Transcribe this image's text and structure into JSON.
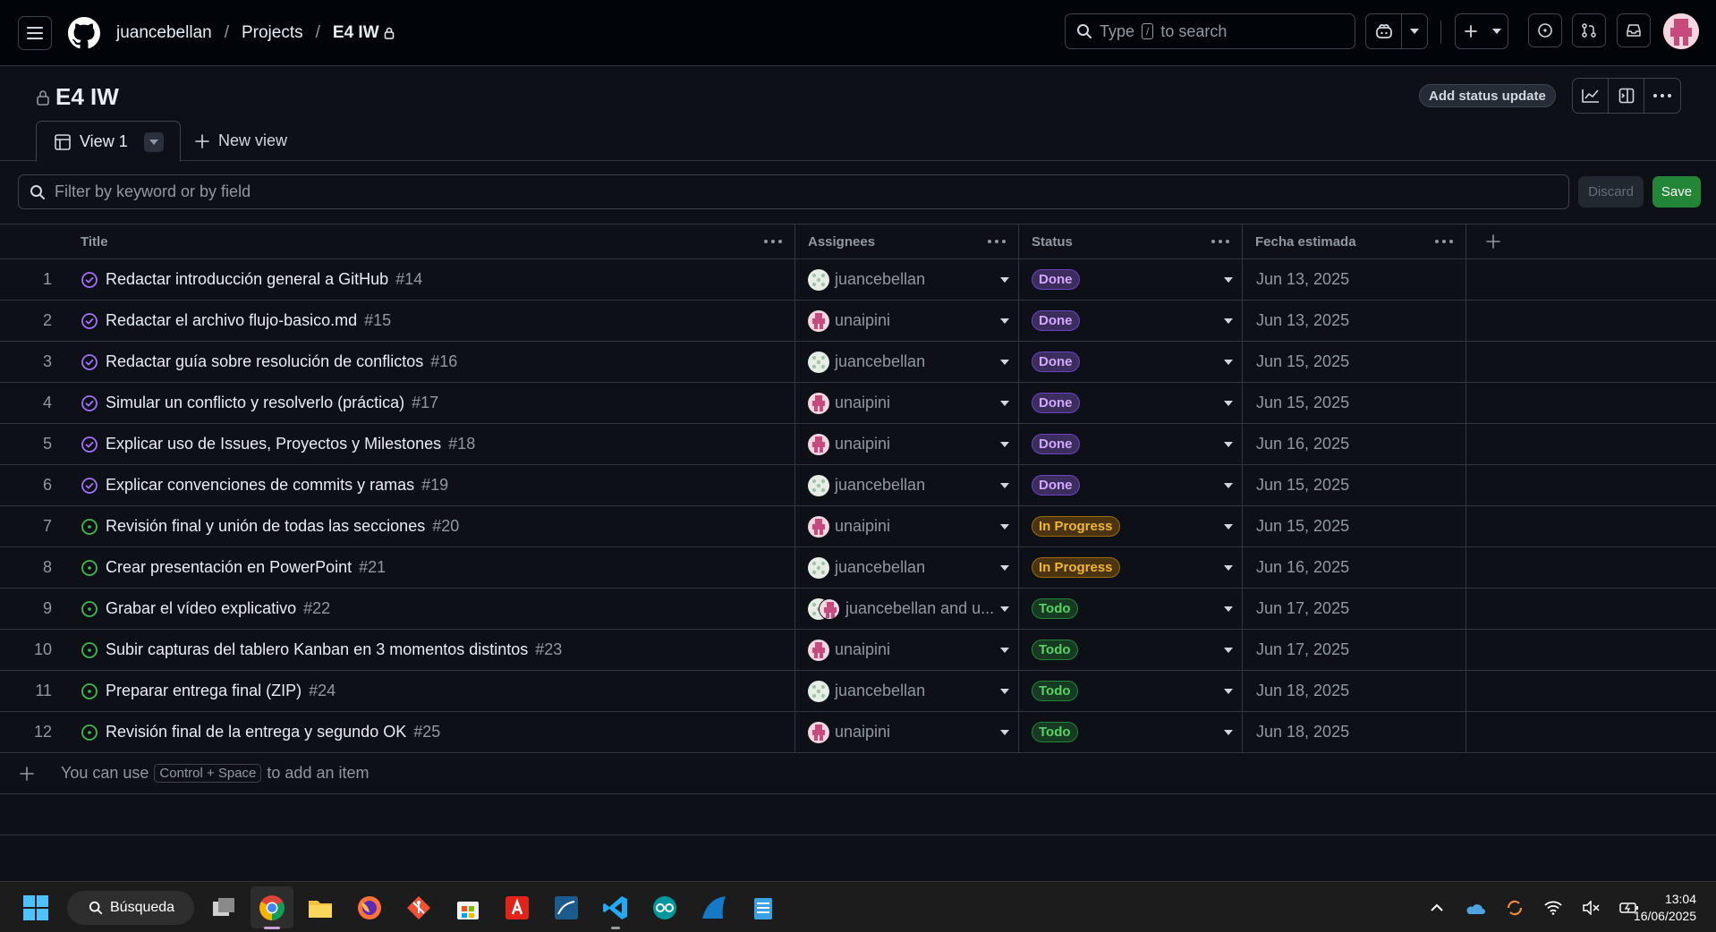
{
  "header": {
    "owner": "juancebellan",
    "projects": "Projects",
    "project": "E4 IW",
    "search_prefix": "Type",
    "search_key": "/",
    "search_suffix": "to search"
  },
  "project": {
    "title": "E4 IW",
    "status_update": "Add status update",
    "tab_label": "View 1",
    "new_view": "New view"
  },
  "filter": {
    "placeholder": "Filter by keyword or by field",
    "discard": "Discard",
    "save": "Save"
  },
  "columns": [
    "Title",
    "Assignees",
    "Status",
    "Fecha estimada"
  ],
  "rows": [
    {
      "n": "1",
      "title": "Redactar introducción general a GitHub",
      "num": "#14",
      "state": "closed",
      "assignee": "juancebellan",
      "avatar": "green",
      "status": "Done",
      "date": "Jun 13, 2025"
    },
    {
      "n": "2",
      "title": "Redactar el archivo flujo-basico.md",
      "num": "#15",
      "state": "closed",
      "assignee": "unaipini",
      "avatar": "pink",
      "status": "Done",
      "date": "Jun 13, 2025"
    },
    {
      "n": "3",
      "title": "Redactar guía sobre resolución de conflictos",
      "num": "#16",
      "state": "closed",
      "assignee": "juancebellan",
      "avatar": "green",
      "status": "Done",
      "date": "Jun 15, 2025"
    },
    {
      "n": "4",
      "title": "Simular un conflicto y resolverlo (práctica)",
      "num": "#17",
      "state": "closed",
      "assignee": "unaipini",
      "avatar": "pink",
      "status": "Done",
      "date": "Jun 15, 2025"
    },
    {
      "n": "5",
      "title": "Explicar uso de Issues, Proyectos y Milestones",
      "num": "#18",
      "state": "closed",
      "assignee": "unaipini",
      "avatar": "pink",
      "status": "Done",
      "date": "Jun 16, 2025"
    },
    {
      "n": "6",
      "title": "Explicar convenciones de commits y ramas",
      "num": "#19",
      "state": "closed",
      "assignee": "juancebellan",
      "avatar": "green",
      "status": "Done",
      "date": "Jun 15, 2025"
    },
    {
      "n": "7",
      "title": "Revisión final y unión de todas las secciones",
      "num": "#20",
      "state": "open",
      "assignee": "unaipini",
      "avatar": "pink",
      "status": "In Progress",
      "date": "Jun 15, 2025"
    },
    {
      "n": "8",
      "title": "Crear presentación en PowerPoint",
      "num": "#21",
      "state": "open",
      "assignee": "juancebellan",
      "avatar": "green",
      "status": "In Progress",
      "date": "Jun 16, 2025"
    },
    {
      "n": "9",
      "title": "Grabar el vídeo explicativo",
      "num": "#22",
      "state": "open",
      "assignee": "juancebellan and u...",
      "avatar": "both",
      "status": "Todo",
      "date": "Jun 17, 2025"
    },
    {
      "n": "10",
      "title": "Subir capturas del tablero Kanban en 3 momentos distintos",
      "num": "#23",
      "state": "open",
      "assignee": "unaipini",
      "avatar": "pink",
      "status": "Todo",
      "date": "Jun 17, 2025"
    },
    {
      "n": "11",
      "title": "Preparar entrega final (ZIP)",
      "num": "#24",
      "state": "open",
      "assignee": "juancebellan",
      "avatar": "green",
      "status": "Todo",
      "date": "Jun 18, 2025"
    },
    {
      "n": "12",
      "title": "Revisión final de la entrega y segundo OK",
      "num": "#25",
      "state": "open",
      "assignee": "unaipini",
      "avatar": "pink",
      "status": "Todo",
      "date": "Jun 18, 2025"
    }
  ],
  "add_item": {
    "prefix": "You can use",
    "shortcut": "Control + Space",
    "suffix": "to add an item"
  },
  "taskbar": {
    "search": "Búsqueda",
    "time": "13:04",
    "date": "16/06/2025"
  },
  "colors": {
    "background": "#0d1117",
    "done": "#a371f7",
    "open": "#3fb950",
    "save": "#238636"
  }
}
